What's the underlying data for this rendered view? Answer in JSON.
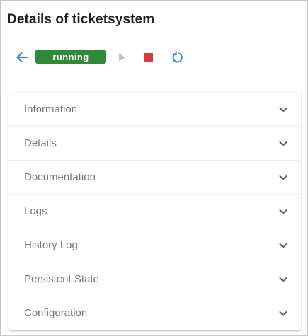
{
  "page": {
    "title": "Details of ticketsystem"
  },
  "toolbar": {
    "back_icon": "arrow-left-icon",
    "status": "running",
    "status_color": "#2f8a36",
    "play_icon": "play-icon",
    "stop_icon": "stop-icon",
    "restart_icon": "restart-icon",
    "accent_color": "#2b8fd0",
    "stop_color": "#d23c3c"
  },
  "accordion": {
    "items": [
      {
        "label": "Information"
      },
      {
        "label": "Details"
      },
      {
        "label": "Documentation"
      },
      {
        "label": "Logs"
      },
      {
        "label": "History Log"
      },
      {
        "label": "Persistent State"
      },
      {
        "label": "Configuration"
      }
    ],
    "chevron_icon": "chevron-down-icon"
  }
}
